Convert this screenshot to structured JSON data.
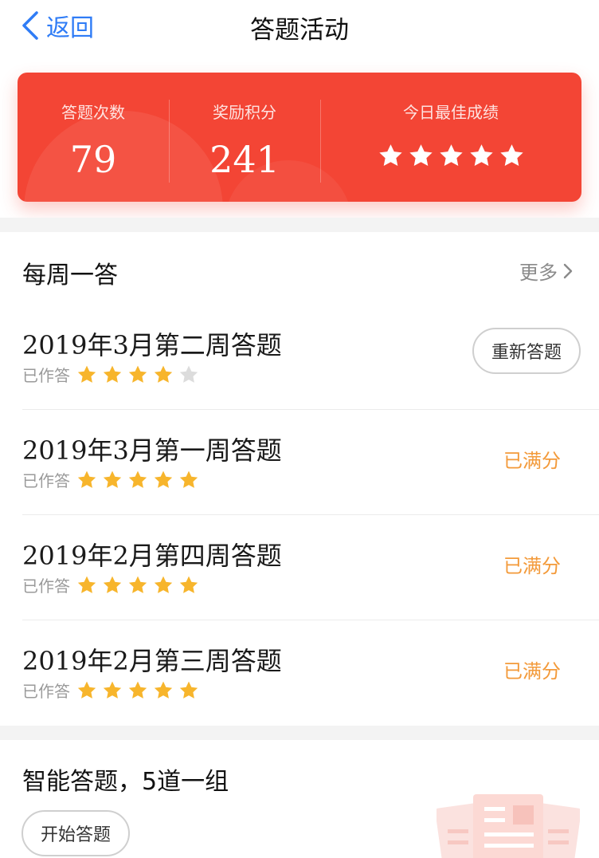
{
  "header": {
    "back_label": "返回",
    "title": "答题活动"
  },
  "stats": {
    "count_label": "答题次数",
    "count_value": "79",
    "points_label": "奖励积分",
    "points_value": "241",
    "best_label": "今日最佳成绩",
    "best_stars": 5
  },
  "weekly": {
    "title": "每周一答",
    "more_label": "更多",
    "items": [
      {
        "title": "2019年3月第二周答题",
        "status": "已作答",
        "stars": 4,
        "action_label": "重新答题"
      },
      {
        "title": "2019年3月第一周答题",
        "status": "已作答",
        "stars": 5,
        "result": "已满分"
      },
      {
        "title": "2019年2月第四周答题",
        "status": "已作答",
        "stars": 5,
        "result": "已满分"
      },
      {
        "title": "2019年2月第三周答题",
        "status": "已作答",
        "stars": 5,
        "result": "已满分"
      }
    ]
  },
  "smart": {
    "title": "智能答题，5道一组",
    "start_label": "开始答题"
  },
  "colors": {
    "brand_red": "#f34535",
    "link_blue": "#2f7cf6",
    "star_gold": "#f7b52c",
    "star_gray": "#dcdcdc",
    "result_orange": "#f39a3a"
  }
}
